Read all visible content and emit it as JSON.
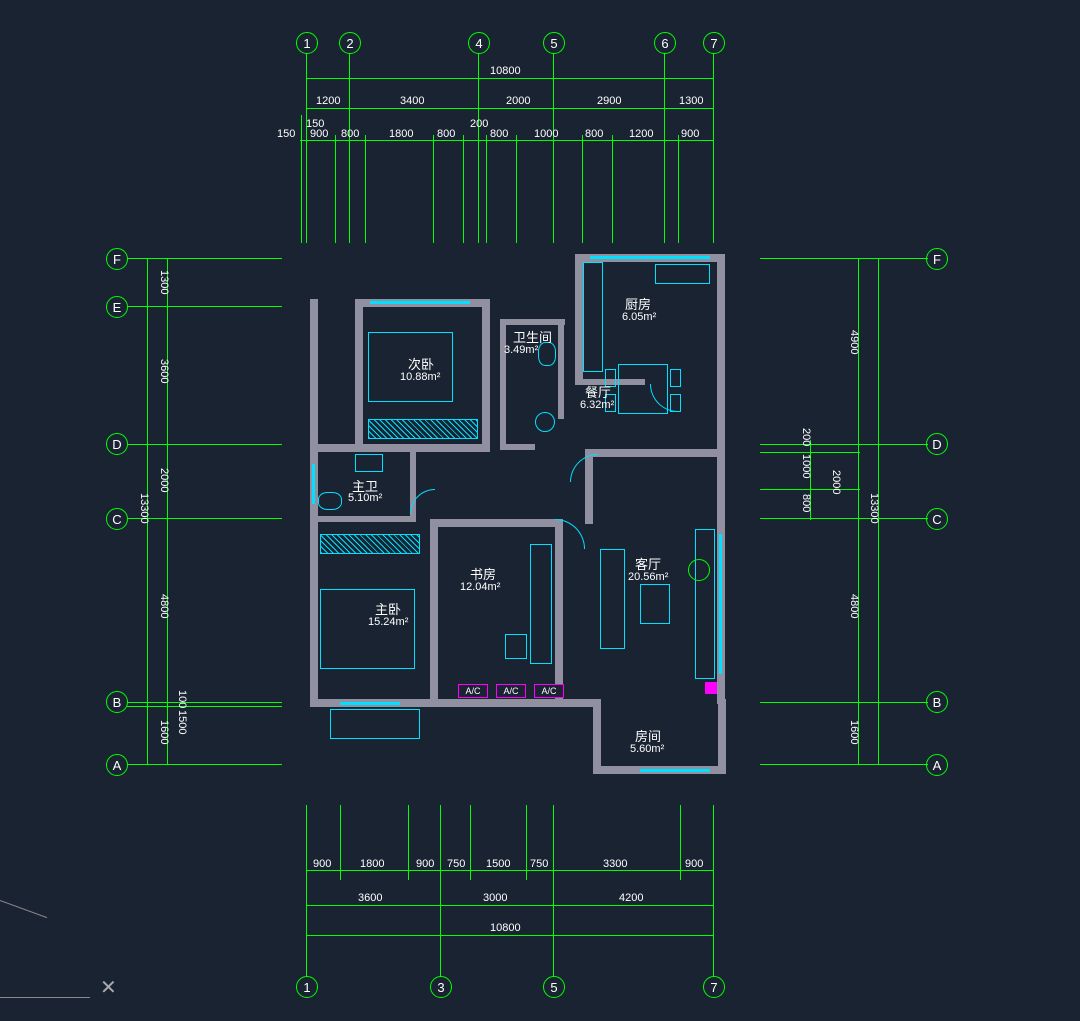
{
  "grid": {
    "top_numbers": [
      "1",
      "2",
      "4",
      "5",
      "6",
      "7"
    ],
    "bottom_numbers": [
      "1",
      "3",
      "5",
      "7"
    ],
    "left_letters": [
      "F",
      "E",
      "D",
      "C",
      "B",
      "A"
    ],
    "right_letters": [
      "F",
      "D",
      "C",
      "B",
      "A"
    ]
  },
  "dims": {
    "top_total": "10800",
    "top_row1": [
      "1200",
      "3400",
      "2000",
      "2900",
      "1300"
    ],
    "top_row2_prefix": "150",
    "top_row2": [
      "150",
      "900",
      "800",
      "1800",
      "800",
      "200",
      "800",
      "1000",
      "800",
      "1200",
      "900"
    ],
    "bottom_row1": [
      "900",
      "1800",
      "900",
      "750",
      "1500",
      "750",
      "3300",
      "900"
    ],
    "bottom_row2": [
      "3600",
      "3000",
      "4200"
    ],
    "bottom_total": "10800",
    "left_col1": [
      "1300",
      "3600",
      "2000",
      "4800",
      "100",
      "1600"
    ],
    "left_col1_sub": "1500",
    "left_total": "13300",
    "right_col1": [
      "4900",
      "200",
      "1000",
      "800",
      "4800",
      "1600"
    ],
    "right_col1_sub": "2000",
    "right_total": "13300"
  },
  "rooms": {
    "kitchen": {
      "name": "厨房",
      "area": "6.05m²"
    },
    "bath": {
      "name": "卫生间",
      "area": "3.49m²"
    },
    "dining": {
      "name": "餐厅",
      "area": "6.32m²"
    },
    "sec_bed": {
      "name": "次卧",
      "area": "10.88m²"
    },
    "master_bath": {
      "name": "主卫",
      "area": "5.10m²"
    },
    "study": {
      "name": "书房",
      "area": "12.04m²"
    },
    "master_bed": {
      "name": "主卧",
      "area": "15.24m²"
    },
    "living": {
      "name": "客厅",
      "area": "20.56m²"
    },
    "room": {
      "name": "房间",
      "area": "5.60m²"
    }
  },
  "ac": "A/C"
}
